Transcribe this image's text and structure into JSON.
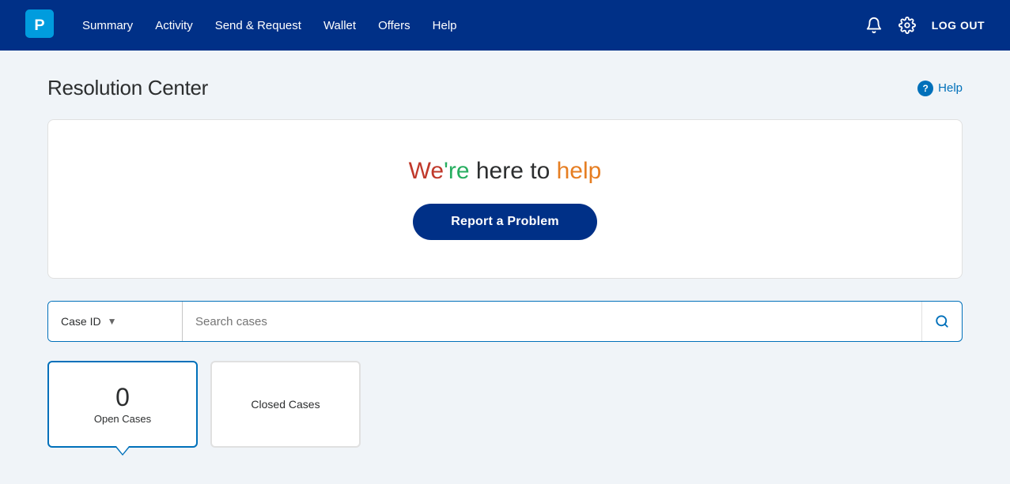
{
  "navbar": {
    "logo_alt": "PayPal",
    "links": [
      {
        "id": "summary",
        "label": "Summary"
      },
      {
        "id": "activity",
        "label": "Activity"
      },
      {
        "id": "send-request",
        "label": "Send & Request"
      },
      {
        "id": "wallet",
        "label": "Wallet"
      },
      {
        "id": "offers",
        "label": "Offers"
      },
      {
        "id": "help",
        "label": "Help"
      }
    ],
    "logout_label": "LOG OUT",
    "bell_icon": "🔔",
    "gear_icon": "⚙"
  },
  "page": {
    "title": "Resolution Center",
    "help_label": "Help",
    "help_icon": "?"
  },
  "hero": {
    "title_we": "We",
    "title_re": "'re",
    "title_here": " here to ",
    "title_help": "help",
    "report_button": "Report a Problem"
  },
  "search": {
    "dropdown_label": "Case ID",
    "placeholder": "Search cases",
    "search_icon": "🔍"
  },
  "cases": {
    "open": {
      "count": "0",
      "label": "Open Cases"
    },
    "closed": {
      "label": "Closed Cases"
    }
  }
}
